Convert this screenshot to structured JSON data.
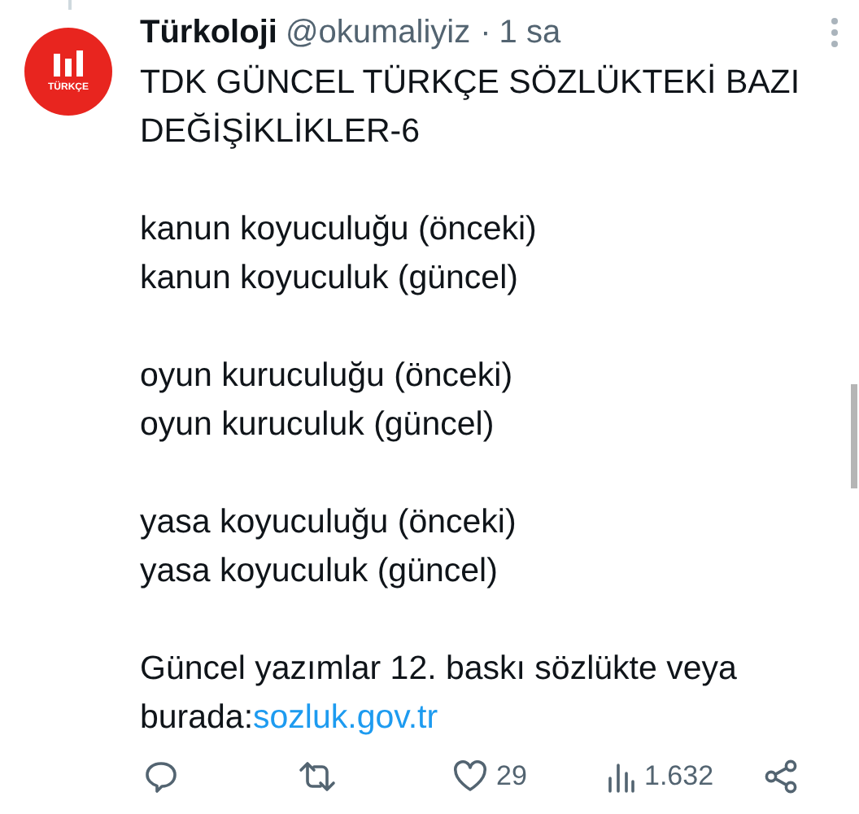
{
  "author": {
    "name": "Türkoloji",
    "handle": "@okumaliyiz",
    "separator": "·",
    "time": "1 sa",
    "avatar_text": "TÜRKÇE"
  },
  "paragraphs": [
    {
      "lines": [
        "TDK GÜNCEL TÜRKÇE SÖZLÜKTEKİ BAZI",
        "DEĞİŞİKLİKLER-6"
      ]
    },
    {
      "lines": [
        "kanun koyuculuğu (önceki)",
        "kanun koyuculuk (güncel)"
      ]
    },
    {
      "lines": [
        "oyun kuruculuğu (önceki)",
        "oyun kuruculuk (güncel)"
      ]
    },
    {
      "lines": [
        "yasa koyuculuğu (önceki)",
        "yasa koyuculuk (güncel)"
      ]
    },
    {
      "lines": [
        "Güncel yazımlar 12. baskı sözlükte veya",
        "burada:"
      ],
      "link": "sozluk.gov.tr"
    }
  ],
  "actions": [
    {
      "kind": "reply"
    },
    {
      "kind": "retweet"
    },
    {
      "kind": "like",
      "count": "29"
    },
    {
      "kind": "views",
      "count": "1.632"
    },
    {
      "kind": "share"
    }
  ]
}
